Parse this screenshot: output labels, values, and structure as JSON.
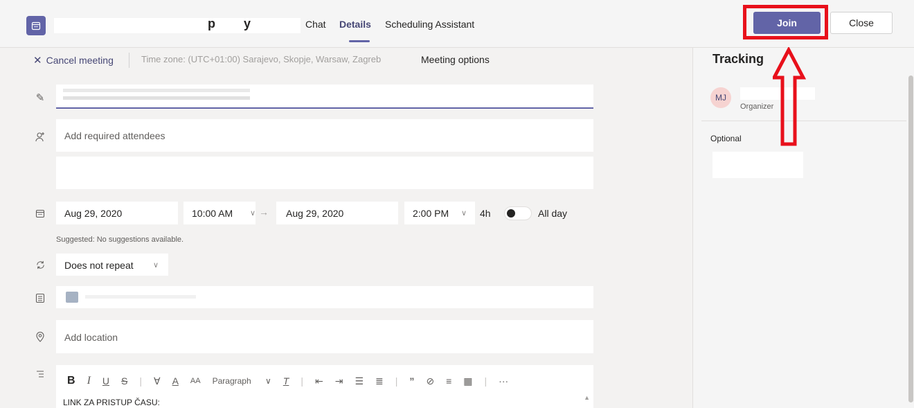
{
  "header": {
    "tabs": [
      "Chat",
      "Details",
      "Scheduling Assistant"
    ],
    "title_fragment": "p y",
    "join_label": "Join",
    "close_label": "Close"
  },
  "toolbar": {
    "cancel_label": "Cancel meeting",
    "timezone": "Time zone: (UTC+01:00) Sarajevo, Skopje, Warsaw, Zagreb",
    "meeting_options": "Meeting options"
  },
  "form": {
    "attendees_placeholder": "Add required attendees",
    "start_date": "Aug 29, 2020",
    "start_time": "10:00 AM",
    "end_date": "Aug 29, 2020",
    "end_time": "2:00 PM",
    "duration": "4h",
    "all_day": "All day",
    "suggested": "Suggested: No suggestions available.",
    "repeat": "Does not repeat",
    "location_placeholder": "Add location",
    "paragraph": "Paragraph",
    "body_text": "LINK ZA PRISTUP ČASU:"
  },
  "tracking": {
    "title": "Tracking",
    "organizer_initials": "MJ",
    "organizer_role": "Organizer",
    "optional_label": "Optional"
  },
  "colors": {
    "accent": "#6264a7",
    "highlight": "#e8101b"
  }
}
